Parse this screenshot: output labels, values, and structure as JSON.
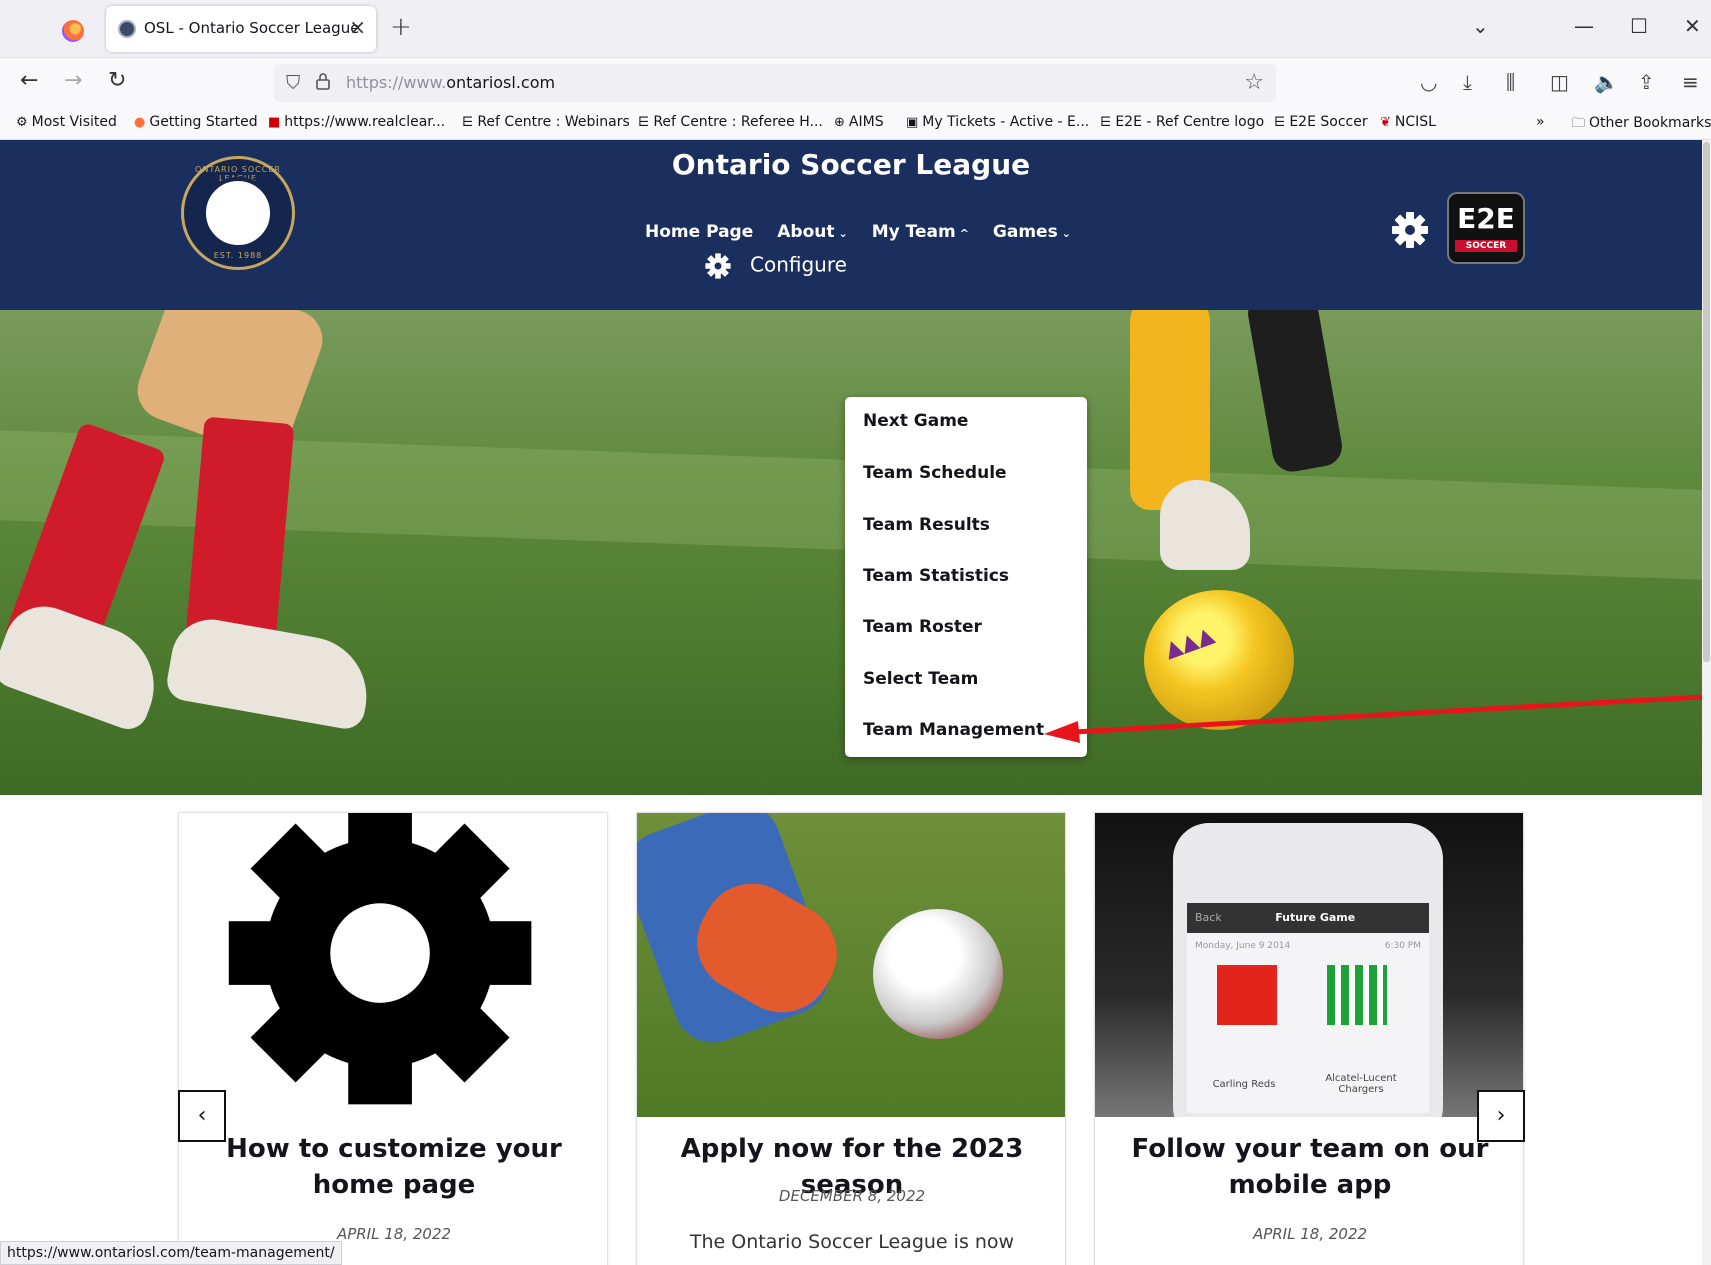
{
  "browser": {
    "tab_title": "OSL - Ontario Soccer League",
    "url_prefix": "https://www.",
    "url_domain": "ontariosl.com",
    "bookmarks": [
      "Most Visited",
      "Getting Started",
      "https://www.realclear...",
      "Ref Centre : Webinars",
      "Ref Centre : Referee H...",
      "AIMS",
      "My Tickets - Active - E...",
      "E2E - Ref Centre logo",
      "E2E Soccer",
      "NCISL"
    ],
    "other_bookmarks": "Other Bookmarks",
    "status_url": "https://www.ontariosl.com/team-management/"
  },
  "site": {
    "title": "Ontario Soccer League",
    "logo_text": "ONTARIO SOCCER LEAGUE",
    "logo_est": "EST. 1988",
    "nav": [
      "Home Page",
      "About",
      "My Team",
      "Games"
    ],
    "configure_label": "Configure",
    "e2e_badge": "E2E",
    "e2e_badge_sub": "SOCCER"
  },
  "my_team_menu": [
    "Next Game",
    "Team Schedule",
    "Team Results",
    "Team Statistics",
    "Team Roster",
    "Select Team",
    "Team Management"
  ],
  "cards": [
    {
      "title": "How to customize your home page",
      "date": "APRIL 18, 2022",
      "snippet": ""
    },
    {
      "title": "Apply now for the 2023 season",
      "date": "DECEMBER 8, 2022",
      "snippet": "The Ontario Soccer League is now"
    },
    {
      "title": "Follow your team on our mobile app",
      "date": "APRIL 18, 2022",
      "snippet": ""
    }
  ],
  "phone_mock": {
    "back": "Back",
    "header": "Future Game",
    "date": "Monday, June 9 2014",
    "time": "6:30 PM",
    "team_home": "Carling Reds",
    "team_away": "Alcatel-Lucent Chargers"
  },
  "colors": {
    "header_bg": "#1b2f5e",
    "annotation_arrow": "#e8141b"
  }
}
